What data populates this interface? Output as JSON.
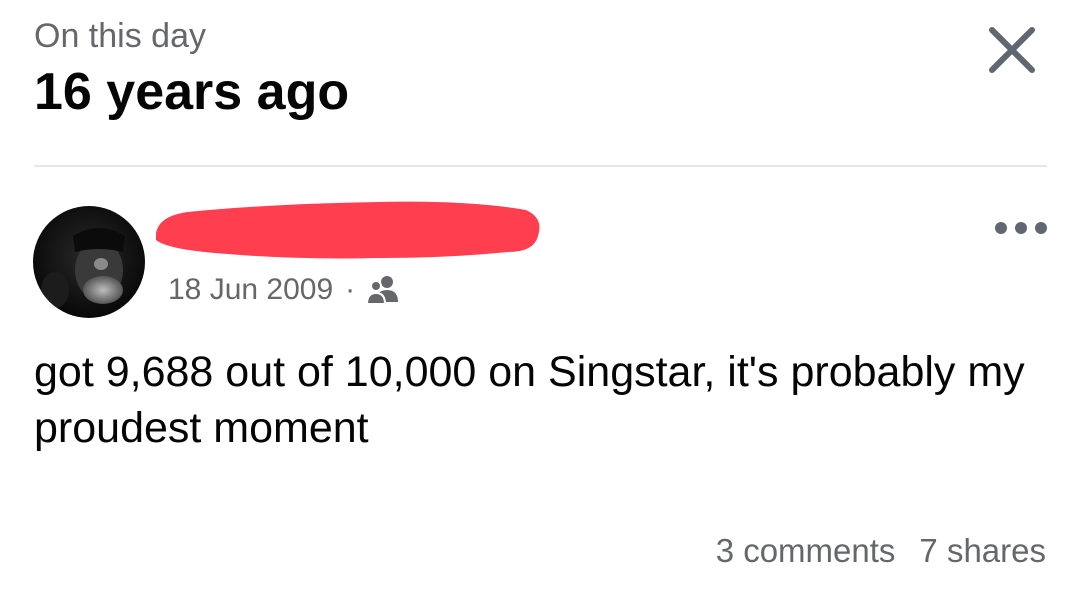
{
  "header": {
    "subtitle": "On this day",
    "title": "16 years ago",
    "close_icon": "close-icon"
  },
  "post": {
    "author_name_redacted": true,
    "redaction_color": "#ff3f4f",
    "date": "18 Jun 2009",
    "separator": "·",
    "audience_icon": "friends-icon",
    "more_icon": "more-options-icon",
    "text": "got 9,688 out of 10,000 on Singstar, it's probably my proudest moment",
    "comments": "3 comments",
    "shares": "7 shares"
  }
}
